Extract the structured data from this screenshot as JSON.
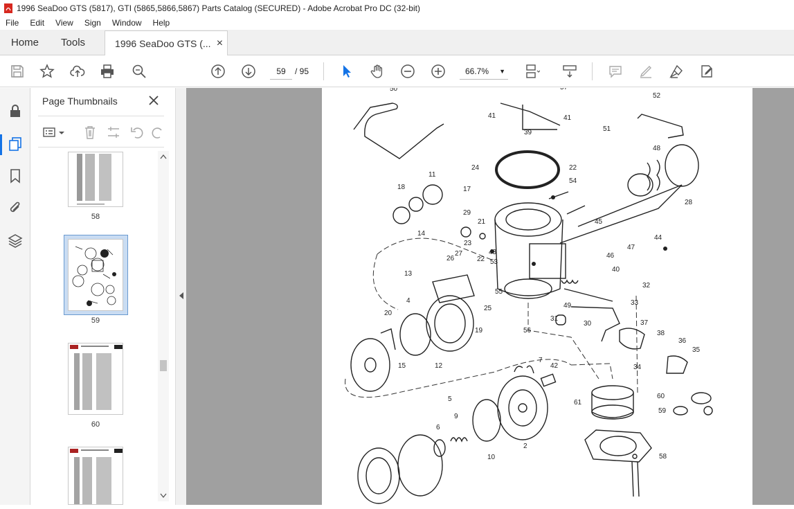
{
  "window": {
    "title": "1996 SeaDoo GTS (5817), GTI (5865,5866,5867) Parts Catalog (SECURED) - Adobe Acrobat Pro DC (32-bit)"
  },
  "menu": [
    "File",
    "Edit",
    "View",
    "Sign",
    "Window",
    "Help"
  ],
  "tabs": {
    "home": "Home",
    "tools": "Tools",
    "document": "1996 SeaDoo GTS (...",
    "close": "×"
  },
  "toolbar": {
    "current_page": "59",
    "page_total": "/ 95",
    "zoom": "66.7%"
  },
  "thumbnails_panel": {
    "title": "Page Thumbnails",
    "pages": [
      "58",
      "59",
      "60"
    ]
  },
  "diagram": {
    "callouts": [
      "50",
      "57",
      "41",
      "41",
      "39",
      "52",
      "51",
      "48",
      "24",
      "22",
      "54",
      "11",
      "17",
      "18",
      "14",
      "29",
      "21",
      "28",
      "45",
      "23",
      "44",
      "47",
      "46",
      "27",
      "26",
      "43",
      "53",
      "22",
      "13",
      "55",
      "25",
      "40",
      "4",
      "32",
      "33",
      "49",
      "20",
      "19",
      "56",
      "31",
      "30",
      "37",
      "38",
      "36",
      "35",
      "34",
      "12",
      "15",
      "7",
      "42",
      "60",
      "59",
      "5",
      "61",
      "6",
      "9",
      "2",
      "10",
      "58"
    ]
  },
  "colors": {
    "accent": "#1473e6",
    "doc_background": "#a0a0a0"
  }
}
